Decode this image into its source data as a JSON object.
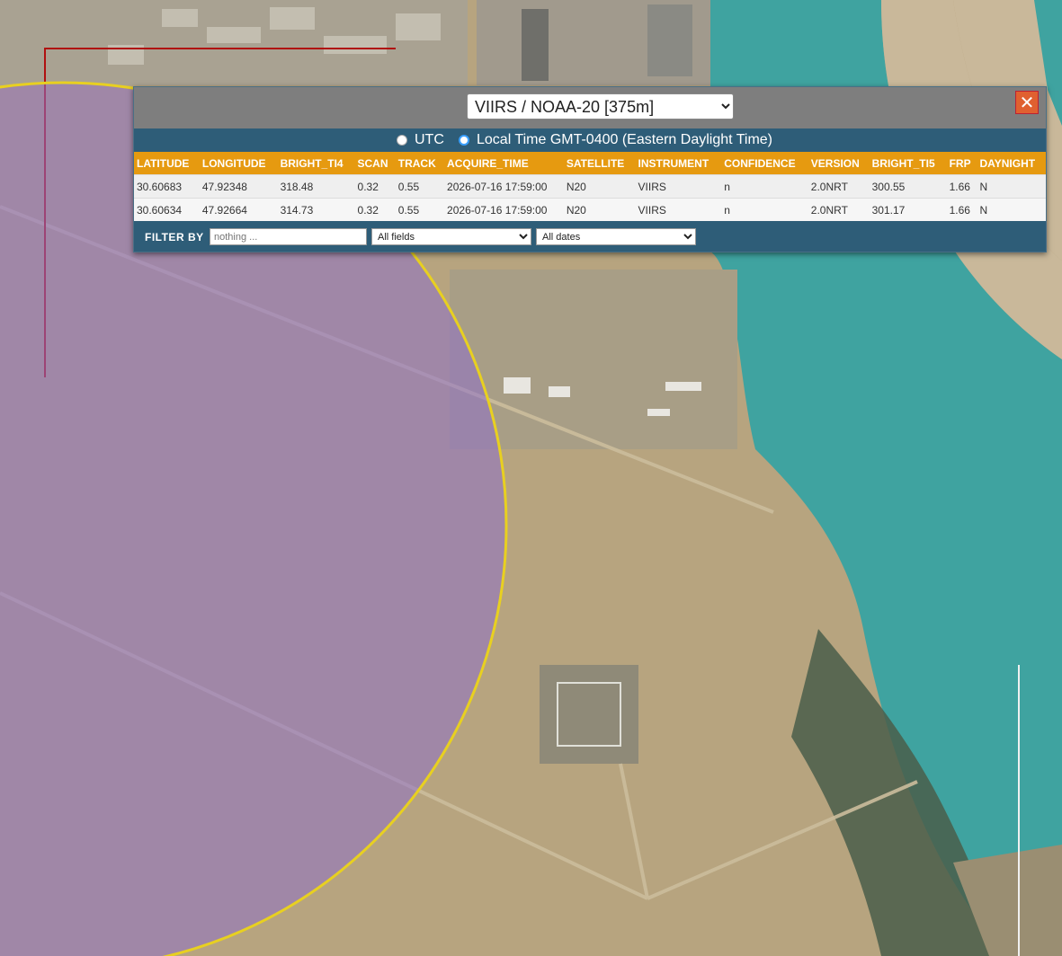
{
  "dataset": {
    "selected": "VIIRS / NOAA-20 [375m]",
    "options": [
      "VIIRS / NOAA-20 [375m]"
    ]
  },
  "close_label": "✕",
  "timezone": {
    "utc_label": "UTC",
    "local_label": "Local Time GMT-0400 (Eastern Daylight Time)",
    "selected": "local"
  },
  "table": {
    "headers": [
      "LATITUDE",
      "LONGITUDE",
      "BRIGHT_TI4",
      "SCAN",
      "TRACK",
      "ACQUIRE_TIME",
      "SATELLITE",
      "INSTRUMENT",
      "CONFIDENCE",
      "VERSION",
      "BRIGHT_TI5",
      "FRP",
      "DAYNIGHT"
    ],
    "rows": [
      [
        "30.60683",
        "47.92348",
        "318.48",
        "0.32",
        "0.55",
        "2026-07-16 17:59:00",
        "N20",
        "VIIRS",
        "n",
        "2.0NRT",
        "300.55",
        "1.66",
        "N"
      ],
      [
        "30.60634",
        "47.92664",
        "314.73",
        "0.32",
        "0.55",
        "2026-07-16 17:59:00",
        "N20",
        "VIIRS",
        "n",
        "2.0NRT",
        "301.17",
        "1.66",
        "N"
      ]
    ]
  },
  "filter": {
    "label": "FILTER BY",
    "placeholder": "nothing ...",
    "fields_selected": "All fields",
    "dates_selected": "All dates"
  },
  "colors": {
    "panel": "#2e5d78",
    "header_row": "#e69a10",
    "circle_fill": "#8e70c8",
    "circle_stroke": "#e8d020",
    "water": "#3fa3a0"
  }
}
